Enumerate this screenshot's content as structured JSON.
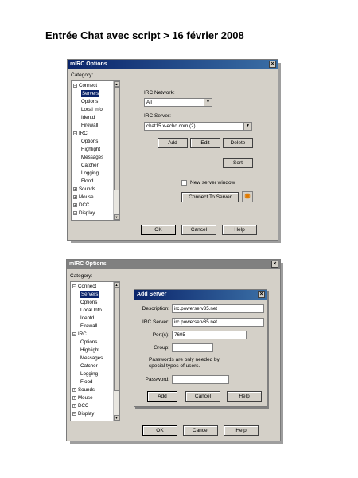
{
  "page_title": "Entrée Chat avec script > 16 février 2008",
  "window1": {
    "title": "mIRC Options",
    "close": "×",
    "category_label": "Category:",
    "tree": [
      {
        "label": "Connect",
        "pm": "−"
      },
      {
        "label": "Servers",
        "selected": true
      },
      {
        "label": "Options"
      },
      {
        "label": "Local Info"
      },
      {
        "label": "Identd"
      },
      {
        "label": "Firewall"
      },
      {
        "label": "IRC",
        "pm": "−"
      },
      {
        "label": "Options"
      },
      {
        "label": "Highlight"
      },
      {
        "label": "Messages"
      },
      {
        "label": "Catcher"
      },
      {
        "label": "Logging"
      },
      {
        "label": "Flood"
      },
      {
        "label": "Sounds",
        "pm": "+"
      },
      {
        "label": "Mouse",
        "pm": "+"
      },
      {
        "label": "DCC",
        "pm": "+"
      },
      {
        "label": "Display",
        "pm": "−"
      }
    ],
    "irc_network_label": "IRC Network:",
    "irc_network_value": "All",
    "irc_server_label": "IRC Server:",
    "irc_server_value": "chat15.x-echo.com (2)",
    "add": "Add",
    "edit": "Edit",
    "delete": "Delete",
    "sort": "Sort",
    "new_window": "New server window",
    "connect": "Connect To Server",
    "ok": "OK",
    "cancel": "Cancel",
    "help": "Help"
  },
  "window2": {
    "title": "mIRC Options",
    "close": "×",
    "category_label": "Category:",
    "tree": [
      {
        "label": "Connect",
        "pm": "−"
      },
      {
        "label": "Servers",
        "selected": true
      },
      {
        "label": "Options"
      },
      {
        "label": "Local Info"
      },
      {
        "label": "Identd"
      },
      {
        "label": "Firewall"
      },
      {
        "label": "IRC",
        "pm": "−"
      },
      {
        "label": "Options"
      },
      {
        "label": "Highlight"
      },
      {
        "label": "Messages"
      },
      {
        "label": "Catcher"
      },
      {
        "label": "Logging"
      },
      {
        "label": "Flood"
      },
      {
        "label": "Sounds",
        "pm": "+"
      },
      {
        "label": "Mouse",
        "pm": "+"
      },
      {
        "label": "DCC",
        "pm": "+"
      },
      {
        "label": "Display",
        "pm": "−"
      }
    ],
    "ok": "OK",
    "cancel": "Cancel",
    "help": "Help"
  },
  "add_server": {
    "title": "Add Server",
    "close": "×",
    "description_label": "Description:",
    "description_value": "irc.powerserv35.net",
    "irc_server_label": "IRC Server:",
    "irc_server_value": "irc.powerserv35.net",
    "ports_label": "Port(s):",
    "ports_value": "7605",
    "group_label": "Group:",
    "group_value": "",
    "password_note_1": "Passwords are only needed by",
    "password_note_2": "special types of users.",
    "password_label": "Password:",
    "password_value": "",
    "add": "Add",
    "cancel": "Cancel",
    "help": "Help"
  },
  "icons": {
    "connect_icon": "✹",
    "arrow_down": "▼",
    "arrow_up": "▲"
  },
  "colors": {
    "active_title": "#0a246a",
    "dialog_bg": "#d4d0c8",
    "connect_icon": "#e07a00"
  }
}
